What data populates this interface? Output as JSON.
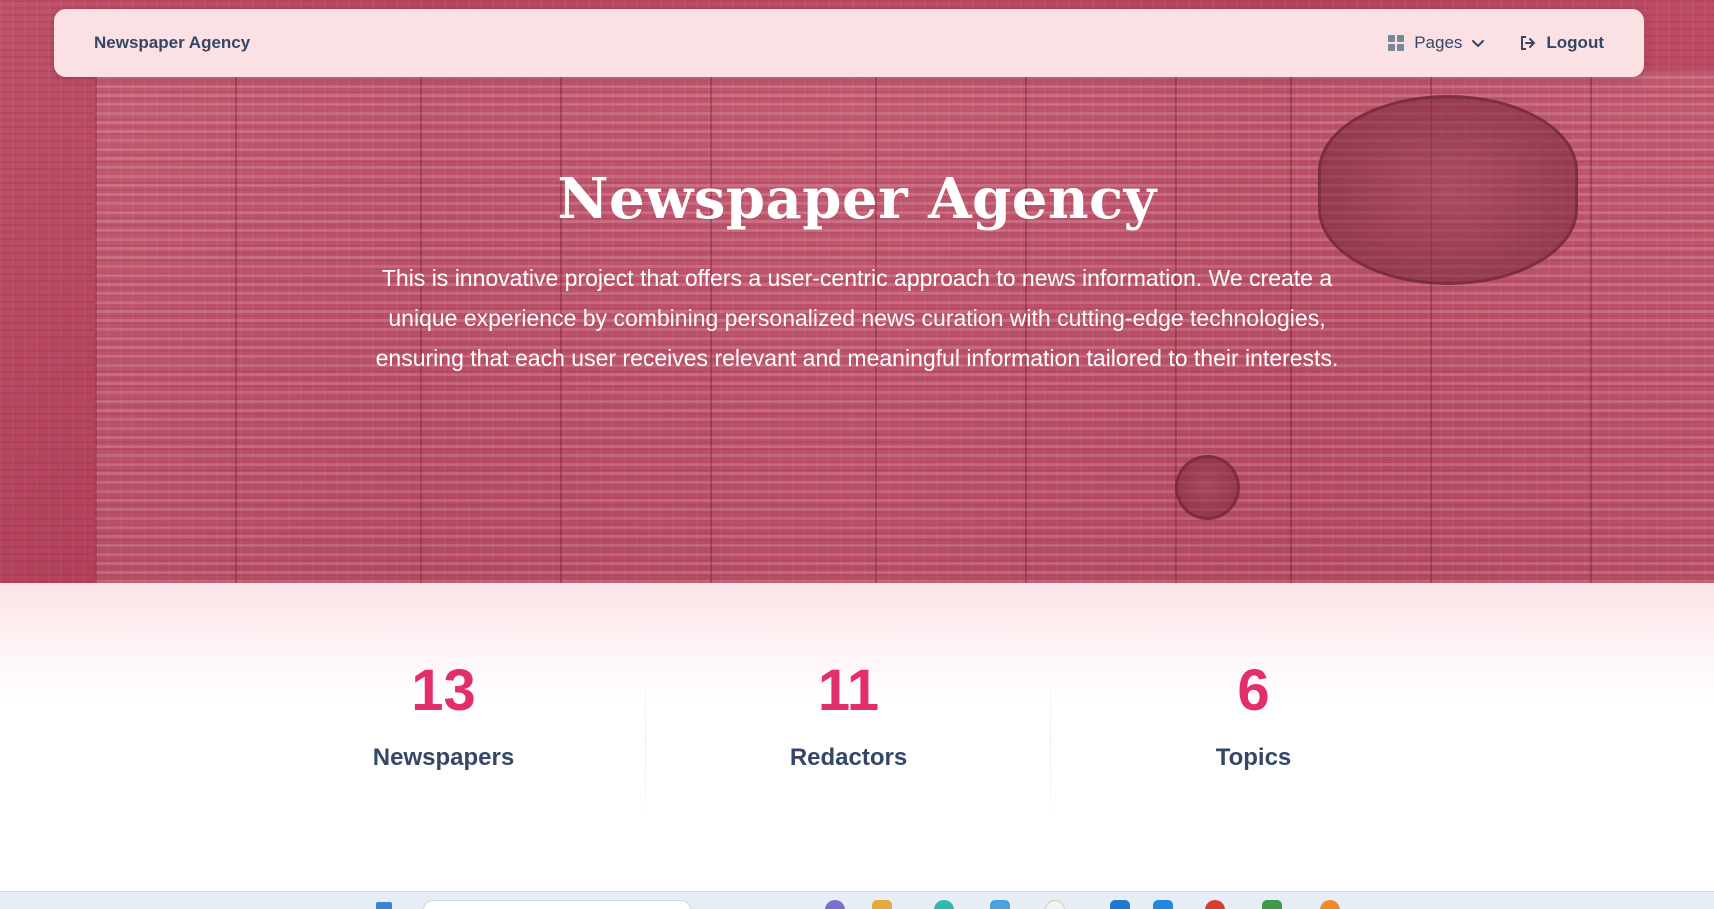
{
  "navbar": {
    "brand": "Newspaper Agency",
    "pages_label": "Pages",
    "logout_label": "Logout",
    "icons": {
      "pages": "grid-icon",
      "dropdown": "chevron-down-icon",
      "logout": "logout-icon"
    }
  },
  "hero": {
    "title": "Newspaper Agency",
    "description": "This is innovative project that offers a user-centric approach to news information. We create a unique experience by combining personalized news curation with cutting-edge technologies, ensuring that each user receives relevant and meaningful information tailored to their interests."
  },
  "stats": [
    {
      "value": "13",
      "label": "Newspapers"
    },
    {
      "value": "11",
      "label": "Redactors"
    },
    {
      "value": "6",
      "label": "Topics"
    }
  ],
  "colors": {
    "accent": "#e22e6c",
    "text_dark": "#344767",
    "navbar_bg": "#fbe0e4",
    "hero_tint": "#c94864"
  }
}
